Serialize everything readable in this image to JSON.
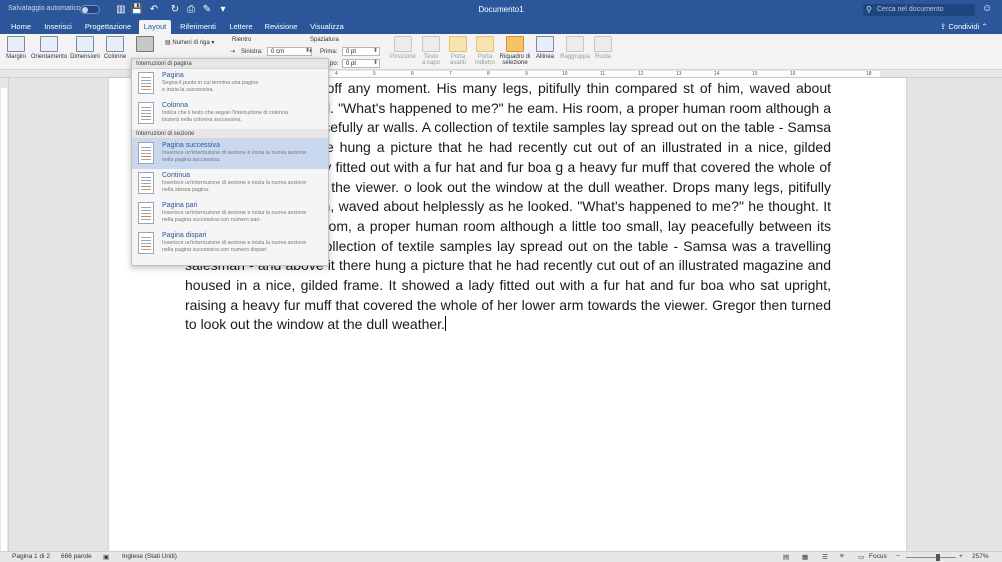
{
  "titlebar": {
    "autosave": "Salvataggio automatico",
    "title": "Documento1",
    "search_placeholder": "Cerca nel documento"
  },
  "tabs": [
    "Home",
    "Inserisci",
    "Progettazione",
    "Layout",
    "Riferimenti",
    "Lettere",
    "Revisione",
    "Visualizza"
  ],
  "active_tab": "Layout",
  "share": "Condividi",
  "ribbon": {
    "margini": "Margini",
    "orientamento": "Orientamento",
    "dimensioni": "Dimensioni",
    "colonne": "Colonne",
    "numeri_riga": "Numeri di riga",
    "rientro": "Rientro",
    "sinistra_label": "Sinistra:",
    "sinistra_value": "0 cm",
    "spaziatura": "Spaziatura",
    "prima_label": "Prima:",
    "prima_value": "0 pt",
    "dopo_label": "po:",
    "dopo_value": "0 pt",
    "posizione": "Posizione",
    "testo_a_capo_1": "Testo",
    "testo_a_capo_2": "a capo",
    "porta_avanti_1": "Porta",
    "porta_avanti_2": "avanti",
    "porta_indietro_1": "Porta",
    "porta_indietro_2": "indietro",
    "riquadro_1": "Riquadro di",
    "riquadro_2": "selezione",
    "allinea": "Allinea",
    "raggruppa": "Raggruppa",
    "ruota": "Ruota"
  },
  "dropdown": {
    "header_page": "Interruzioni di pagina",
    "header_section": "Interruzioni di sezione",
    "items": [
      {
        "title": "Pagina",
        "desc1": "Segna il punto in cui termina una pagina",
        "desc2": "e inizia la successiva."
      },
      {
        "title": "Colonna",
        "desc1": "Indica che il testo che segue l'interruzione di colonna",
        "desc2": "inizierà nella colonna successiva."
      },
      {
        "title": "Pagina successiva",
        "desc1": "Inserisce un'interruzione di sezione e inizia la nuova sezione",
        "desc2": "nella pagina successiva."
      },
      {
        "title": "Continua",
        "desc1": "Inserisce un'interruzione di sezione e inizia la nuova sezione",
        "desc2": "nella stessa pagina."
      },
      {
        "title": "Pagina pari",
        "desc1": "Inserisce un'interruzione di sezione e inizia la nuova sezione",
        "desc2": "nella pagina successiva con numero pari."
      },
      {
        "title": "Pagina dispari",
        "desc1": "Inserisce un'interruzione di sezione e inizia la nuova sezione",
        "desc2": "nella pagina successiva con numero dispari."
      }
    ]
  },
  "ruler_ticks": [
    "4",
    "5",
    "6",
    "7",
    "8",
    "9",
    "10",
    "11",
    "12",
    "13",
    "14",
    "15",
    "16",
    "",
    "18"
  ],
  "document_text": "eemed ready to slide off any moment. His many legs, pitifully thin compared st of him, waved about helplessly as he looked. \"What's happened to me?\" he eam. His room, a proper human room although a little too small, lay peacefully ar walls. A collection of textile samples lay spread out on the table - Samsa was and above it there hung a picture that he had recently cut out of an illustrated in a nice, gilded frame. It showed a lady fitted out with a fur hat and fur boa g a heavy fur muff that covered the whole of her lower arm towards the viewer. o look out the window at the dull weather. Drops many legs, pitifully thin e of the rest of him, waved about helplessly as he looked. \"What's happened to me?\" he thought. It wasn't a dream. His room, a proper human room although a little too small, lay peacefully between its four familiar walls. A collection of textile samples lay spread out on the table - Samsa was a travelling salesman - and above it there hung a picture that he had recently cut out of an illustrated magazine and housed in a nice, gilded frame. It showed a lady fitted out with a fur hat and fur boa who sat upright, raising a heavy fur muff that covered the whole of her lower arm towards the viewer. Gregor then turned to look out the window at the dull weather.",
  "statusbar": {
    "page": "Pagina 1 di 2",
    "words": "666 parole",
    "language": "Inglese (Stati Uniti)",
    "focus": "Focus",
    "zoom": "257%"
  },
  "colors": {
    "accent": "#2b579a",
    "selected_item": "#c9d8ef"
  }
}
